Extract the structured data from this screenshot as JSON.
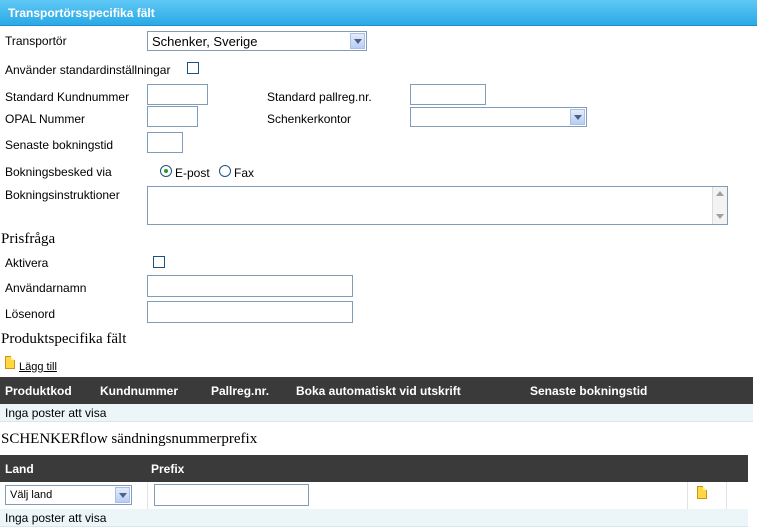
{
  "header": {
    "title": "Transportörsspecifika fält"
  },
  "form": {
    "carrier_label": "Transportör",
    "carrier_value": "Schenker, Sverige",
    "use_defaults_label": "Använder standardinställningar",
    "customer_number_label": "Standard Kundnummer",
    "customer_number_value": "",
    "pallet_reg_label": "Standard pallreg.nr.",
    "pallet_reg_value": "",
    "opal_label": "OPAL Nummer",
    "opal_value": "",
    "office_label": "Schenkerkontor",
    "office_value": "",
    "latest_booking_label": "Senaste bokningstid",
    "latest_booking_value": "",
    "booking_via_label": "Bokningsbesked via",
    "booking_via_email": "E-post",
    "booking_via_fax": "Fax",
    "booking_instructions_label": "Bokningsinstruktioner",
    "booking_instructions_value": ""
  },
  "price_query": {
    "title": "Prisfråga",
    "activate_label": "Aktivera",
    "username_label": "Användarnamn",
    "username_value": "",
    "password_label": "Lösenord",
    "password_value": ""
  },
  "product_fields": {
    "title": "Produktspecifika fält",
    "add_label": "Lägg till",
    "columns": [
      "Produktkod",
      "Kundnummer",
      "Pallreg.nr.",
      "Boka automatiskt vid utskrift",
      "Senaste bokningstid"
    ],
    "empty_text": "Inga poster att visa"
  },
  "flow_prefix": {
    "title": "SCHENKERflow sändningsnummerprefix",
    "columns": [
      "Land",
      "Prefix"
    ],
    "country_select_value": "Välj land",
    "prefix_value": "",
    "empty_text": "Inga poster att visa"
  },
  "colors": {
    "header_blue": "#2aa9e6",
    "table_header": "#3a3a3a",
    "empty_row": "#ecf6f9"
  }
}
